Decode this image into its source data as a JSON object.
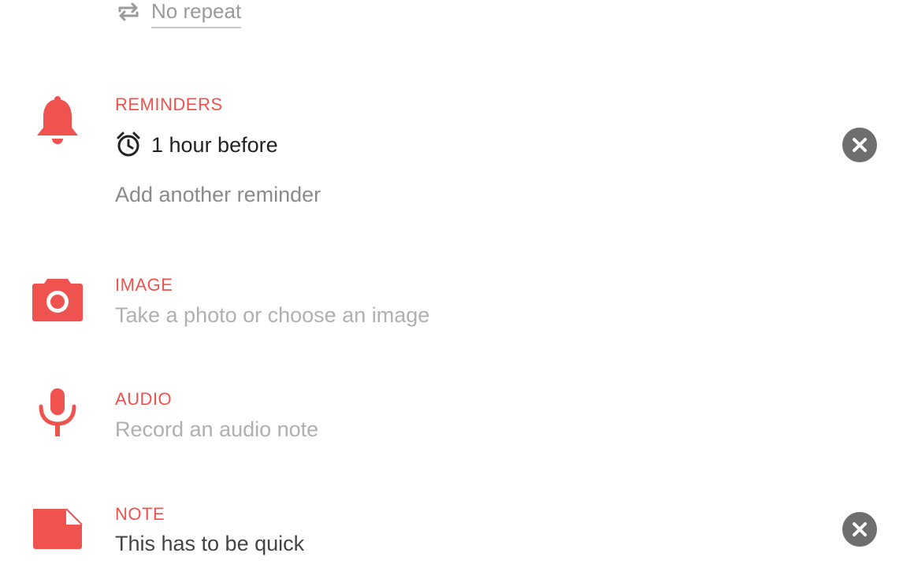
{
  "repeat": {
    "label": "No repeat",
    "icon": "repeat-icon"
  },
  "reminders": {
    "title": "REMINDERS",
    "icon": "bell-icon",
    "items": [
      {
        "label": "1 hour before",
        "icon": "alarm-clock-icon",
        "clear_icon": "clear-icon"
      }
    ],
    "add_label": "Add another reminder"
  },
  "image": {
    "title": "IMAGE",
    "icon": "camera-icon",
    "hint": "Take a photo or choose an image"
  },
  "audio": {
    "title": "AUDIO",
    "icon": "microphone-icon",
    "hint": "Record an audio note"
  },
  "note": {
    "title": "NOTE",
    "icon": "note-icon",
    "value": "This has to be quick",
    "clear_icon": "clear-icon"
  },
  "colors": {
    "accent": "#ef5350",
    "clear_button": "#6e6e6e",
    "secondary_text": "#8a8a8a",
    "hint_text": "#b0b0b0"
  }
}
